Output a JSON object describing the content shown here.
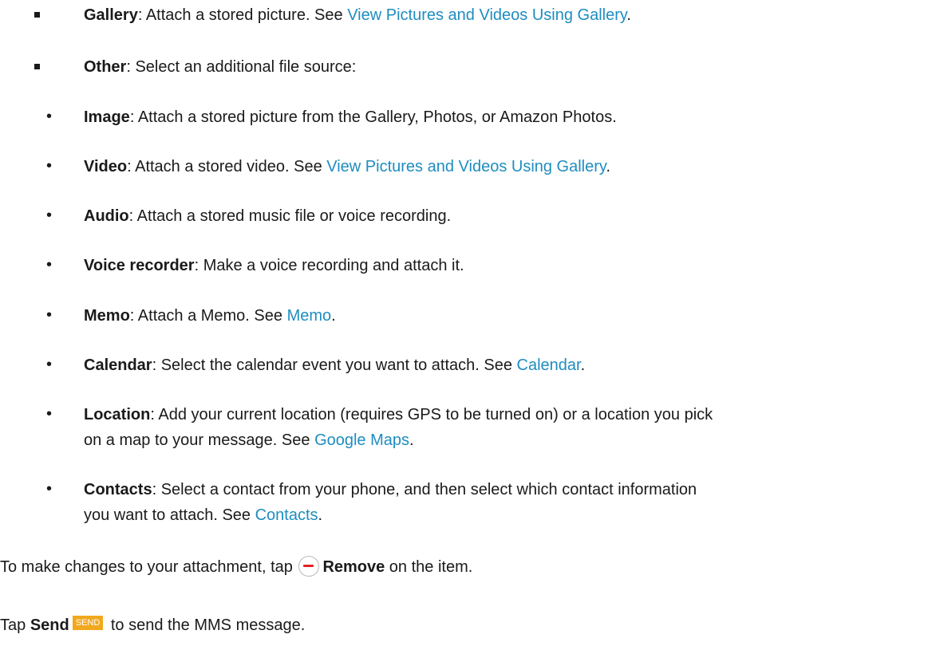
{
  "gallery": {
    "term": "Gallery",
    "text": ": Attach a stored picture. See ",
    "link": "View Pictures and Videos Using Gallery",
    "end": "."
  },
  "other": {
    "term": "Other",
    "text": ": Select an additional file source:"
  },
  "bullet_glyph": "•",
  "items": [
    {
      "term": "Image",
      "text": ": Attach a stored picture from the Gallery, Photos, or Amazon Photos."
    },
    {
      "term": "Video",
      "text": ": Attach a stored video. See ",
      "link": "View Pictures and Videos Using Gallery",
      "end": "."
    },
    {
      "term": "Audio",
      "text": ": Attach a stored music file or voice recording."
    },
    {
      "term": "Voice recorder",
      "text": ": Make a voice recording and attach it."
    },
    {
      "term": "Memo",
      "text": ": Attach a Memo. See ",
      "link": "Memo",
      "end": "."
    },
    {
      "term": "Calendar",
      "text": ": Select the calendar event you want to attach. See ",
      "link": "Calendar",
      "end": "."
    },
    {
      "term": "Location",
      "text": ": Add your current location (requires GPS to be turned on) or a location you pick",
      "line2": "on a map to your message. See ",
      "link": "Google Maps",
      "end": "."
    },
    {
      "term": "Contacts",
      "text": ": Select a contact from your phone, and then select which contact information",
      "line2": "you want to attach. See ",
      "link": "Contacts",
      "end": "."
    }
  ],
  "remove_para": {
    "pre": "To make changes to your attachment, tap ",
    "icon": "remove-icon",
    "term": "Remove",
    "post": " on the item."
  },
  "send_para": {
    "pre": "Tap ",
    "term": "Send",
    "button": "SEND",
    "post": " to send the MMS message."
  },
  "colors": {
    "link": "#1e8dc0",
    "remove_minus": "#e32227",
    "send_button": "#f2a81d"
  }
}
